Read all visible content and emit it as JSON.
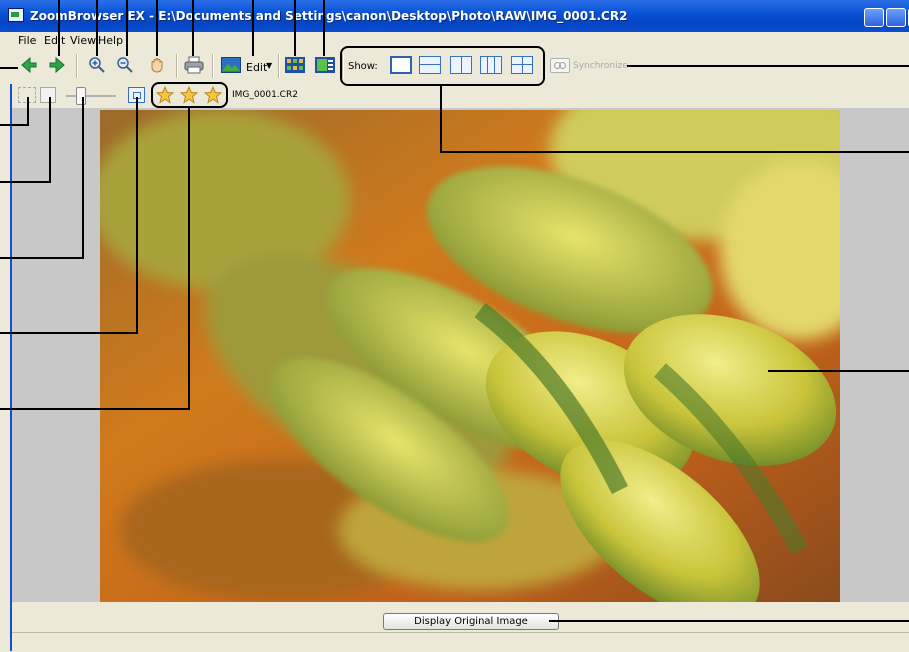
{
  "window": {
    "title": "ZoomBrowser EX - E:\\Documents and Settings\\canon\\Desktop\\Photo\\RAW\\IMG_0001.CR2"
  },
  "menu": {
    "items": [
      "File",
      "Edit",
      "View",
      "Help"
    ]
  },
  "toolbar": {
    "edit_label": "Edit",
    "show_label": "Show:",
    "synchronize_label": "Synchronize",
    "icons": [
      "back-arrow-icon",
      "forward-arrow-icon",
      "zoom-in-icon",
      "zoom-out-icon",
      "hand-icon",
      "print-icon",
      "edit-image-icon",
      "thumbnails-icon",
      "image-details-icon"
    ]
  },
  "toolbar2": {
    "filename": "IMG_0001.CR2",
    "rating_stars": 3
  },
  "display_original_button": "Display Original Image",
  "colors": {
    "titlebar": "#0a53d6",
    "window_bg": "#ece9d8",
    "accent_border": "#2f5fb8"
  }
}
